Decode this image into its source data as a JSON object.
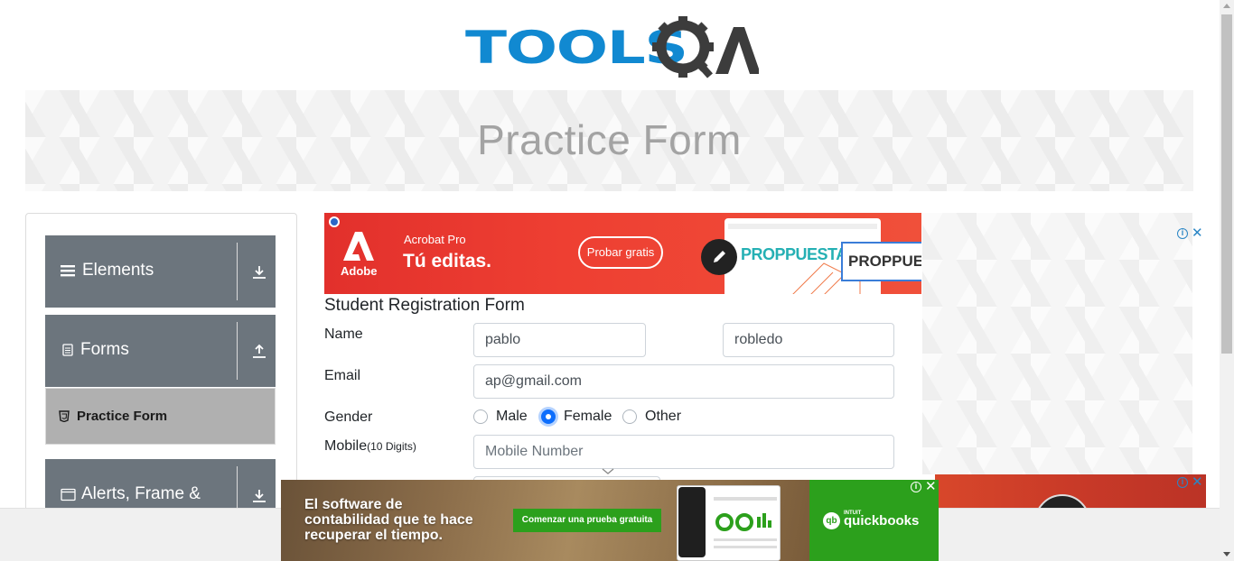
{
  "header": {
    "logo_text": "TOOLSQA"
  },
  "banner": {
    "title": "Practice Form"
  },
  "sidebar": {
    "groups": [
      {
        "label": "Elements",
        "icon": "hamburger-icon",
        "arrow": "download-arrow-icon"
      },
      {
        "label": "Forms",
        "icon": "document-icon",
        "arrow": "upload-arrow-icon"
      },
      {
        "label": "Alerts, Frame &",
        "icon": "window-icon",
        "arrow": "download-arrow-icon"
      }
    ],
    "active_item": {
      "label": "Practice Form",
      "icon": "html5-icon"
    }
  },
  "ad_top": {
    "brand": "Adobe",
    "product": "Acrobat Pro",
    "headline": "Tú editas.",
    "cta": "Probar gratis",
    "doc_brand_1": "PROPPUESTA",
    "doc_brand_2": "PROPPUESTA"
  },
  "form": {
    "title": "Student Registration Form",
    "name_label": "Name",
    "first_name": "pablo",
    "last_name": "robledo",
    "email_label": "Email",
    "email": "ap@gmail.com",
    "gender_label": "Gender",
    "gender_options": [
      "Male",
      "Female",
      "Other"
    ],
    "gender_selected": "Female",
    "mobile_label": "Mobile",
    "mobile_hint": "(10 Digits)",
    "mobile_placeholder": "Mobile Number"
  },
  "ad_right": {
    "info_icon": "info-icon",
    "close_icon": "close-icon"
  },
  "ad_bottom": {
    "copy_line1": "El software de",
    "copy_line2": "contabilidad que te hace",
    "copy_line3": "recuperar el tiempo.",
    "cta": "Comenzar una prueba gratuita",
    "brand_small": "INTUIT",
    "brand": "quickbooks",
    "brand_mark": "qb"
  },
  "colors": {
    "brand_blue": "#1189d1",
    "sidebar_group": "#6c757d",
    "active_item_bg": "#b0b0b0",
    "radio_accent": "#0d6efd",
    "quickbooks_green": "#2ca01c",
    "adobe_red": "#e2302c"
  }
}
